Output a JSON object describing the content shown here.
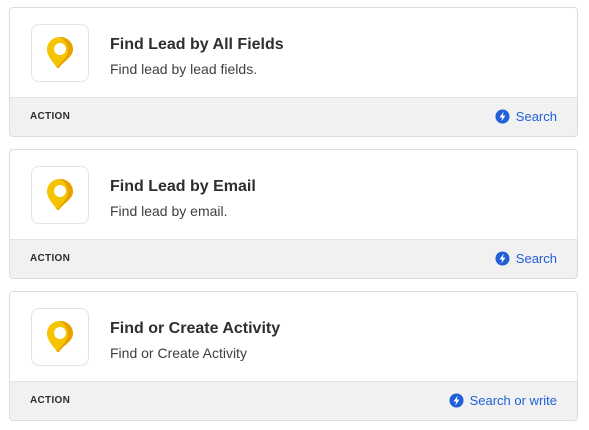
{
  "colors": {
    "accent": "#1f5fd8",
    "app_icon_yellow": "#f5c400",
    "app_icon_orange": "#e08a00"
  },
  "app_icon_name": "location-pin-icon",
  "actions": [
    {
      "title": "Find Lead by All Fields",
      "description": "Find lead by lead fields.",
      "type_label": "ACTION",
      "kind_label": "Search",
      "kind_icon": "bolt-icon"
    },
    {
      "title": "Find Lead by Email",
      "description": "Find lead by email.",
      "type_label": "ACTION",
      "kind_label": "Search",
      "kind_icon": "bolt-icon"
    },
    {
      "title": "Find or Create Activity",
      "description": "Find or Create Activity",
      "type_label": "ACTION",
      "kind_label": "Search or write",
      "kind_icon": "bolt-icon"
    }
  ]
}
